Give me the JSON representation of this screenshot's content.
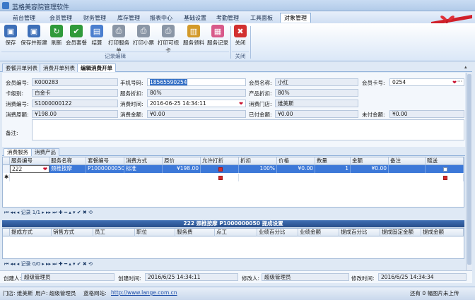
{
  "app": {
    "title": "蓝格美容院管理软件"
  },
  "menu": [
    "前台管理",
    "会员管理",
    "财务管理",
    "库存管理",
    "报表中心",
    "基础设置",
    "考勤管理",
    "工具面板",
    "对象管理"
  ],
  "menu_active": "对象管理",
  "ribbon": {
    "buttons": [
      "保存",
      "保存并新建",
      "刷新",
      "会员套餐",
      "结算",
      "打印服务单",
      "打印小票",
      "打印可视卡",
      "服务领料",
      "服务记录"
    ],
    "group_edit": "记录编辑",
    "close_button": "关闭",
    "group_close": "关闭"
  },
  "doc_tabs": [
    "套餐开单列表",
    "消费开单列表",
    "编辑消费开单"
  ],
  "form": {
    "member_no_label": "会员编号:",
    "member_no": "K000283",
    "phone_label": "手机号码:",
    "phone": "18565590254",
    "member_name_label": "会员名称:",
    "member_name": "小红",
    "card_no_label": "会员卡号:",
    "card_no": "0254",
    "card_type_label": "卡级别:",
    "card_type": "白金卡",
    "service_discount_label": "服务折扣:",
    "service_discount": "80%",
    "product_discount_label": "产品折扣:",
    "product_discount": "80%",
    "consume_no_label": "消费编号:",
    "consume_no": "S1000000122",
    "consume_time_label": "消费时间:",
    "consume_time": "2016-06-25 14:34:11",
    "store_label": "消费门店:",
    "store": "维美斯",
    "original_label": "消费原额:",
    "original": "¥198.00",
    "amount_label": "消费金额:",
    "amount": "¥0.00",
    "paid_label": "已付金额:",
    "paid": "¥0.00",
    "unpaid_label": "未付金额:",
    "unpaid": "¥0.00",
    "remark_label": "备注:"
  },
  "sub_tabs": [
    "消费服务",
    "消费产品"
  ],
  "service_grid": {
    "headers": [
      "服务编号",
      "服务名称",
      "套餐编号",
      "消费方式",
      "原价",
      "允许打折",
      "折扣",
      "价格",
      "数量",
      "金额",
      "备注",
      "赠送"
    ],
    "row": {
      "no": "222",
      "name": "颈椎按摩",
      "package_no": "P1000000050",
      "method": "标准",
      "price_orig": "¥198.00",
      "discount": "100%",
      "price": "¥0.00",
      "qty": "1",
      "amount": "¥0.00"
    }
  },
  "nav_top": {
    "record": "记录 1/1"
  },
  "commission_title": "222 颈椎按摩 P1000000050 提成设置",
  "commission_grid": {
    "headers": [
      "提成方式",
      "销售方式",
      "员工",
      "职位",
      "服务费",
      "点工",
      "业绩百分比",
      "业绩金额",
      "提成百分比",
      "提成固定金额",
      "提成金额"
    ]
  },
  "nav_bottom": {
    "record": "记录 0/0"
  },
  "footer": {
    "creator_label": "创建人:",
    "creator": "超级管理员",
    "create_time_label": "创建时间:",
    "create_time": "2016/6/25 14:34:11",
    "modifier_label": "修改人:",
    "modifier": "超级管理员",
    "modify_time_label": "修改时间:",
    "modify_time": "2016/6/25 14:34:34"
  },
  "status": {
    "store": "门店: 维美斯",
    "user": "用户: 超级管理员",
    "site_label": "蓝格网站:",
    "site_url": "http://www.lange.com.cn",
    "right": "还有 0 幅图片未上传"
  }
}
